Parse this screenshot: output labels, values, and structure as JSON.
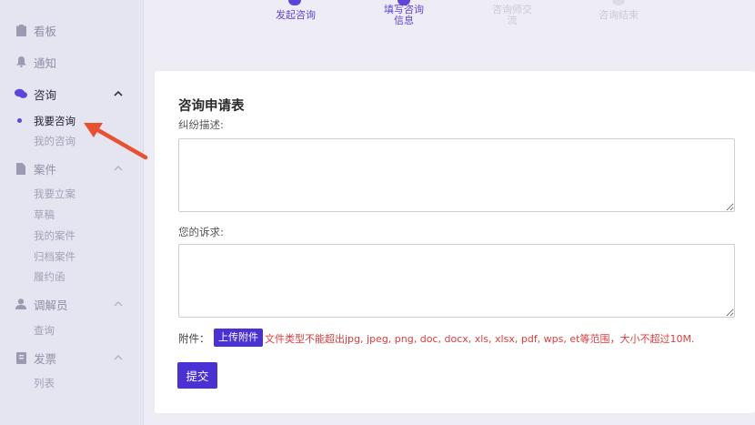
{
  "sidebar": {
    "groups": [
      {
        "label": "看板",
        "icon": "clipboard-icon"
      },
      {
        "label": "通知",
        "icon": "bell-icon"
      },
      {
        "label": "咨询",
        "icon": "chat-bubbles-icon"
      },
      {
        "label": "案件",
        "icon": "document-icon"
      },
      {
        "label": "调解员",
        "icon": "user-icon"
      },
      {
        "label": "发票",
        "icon": "receipt-icon"
      }
    ],
    "consult_items": [
      "我要咨询",
      "我的咨询"
    ],
    "case_items": [
      "我要立案",
      "草稿",
      "我的案件",
      "归档案件",
      "履约函"
    ],
    "mediator_items": [
      "查询"
    ],
    "invoice_items": [
      "列表"
    ]
  },
  "steps": [
    {
      "label": "发起咨询",
      "status": "done"
    },
    {
      "label": "填写咨询信息",
      "status": "active"
    },
    {
      "label": "咨询师交流",
      "status": "todo"
    },
    {
      "label": "咨询结束",
      "status": "todo"
    }
  ],
  "form": {
    "title": "咨询申请表",
    "dispute_label": "纠纷描述:",
    "dispute_value": "",
    "claim_label": "您的诉求:",
    "claim_value": "",
    "attachment_label": "附件：",
    "upload_label": "上传附件",
    "file_hint": "文件类型不能超出jpg, jpeg, png, doc, docx, xls, xlsx, pdf, wps, et等范围，大小不超过10M.",
    "submit_label": "提交"
  },
  "colors": {
    "accent": "#4a31d6",
    "hint": "#e23b3b",
    "annotation_arrow": "#e8512f"
  }
}
